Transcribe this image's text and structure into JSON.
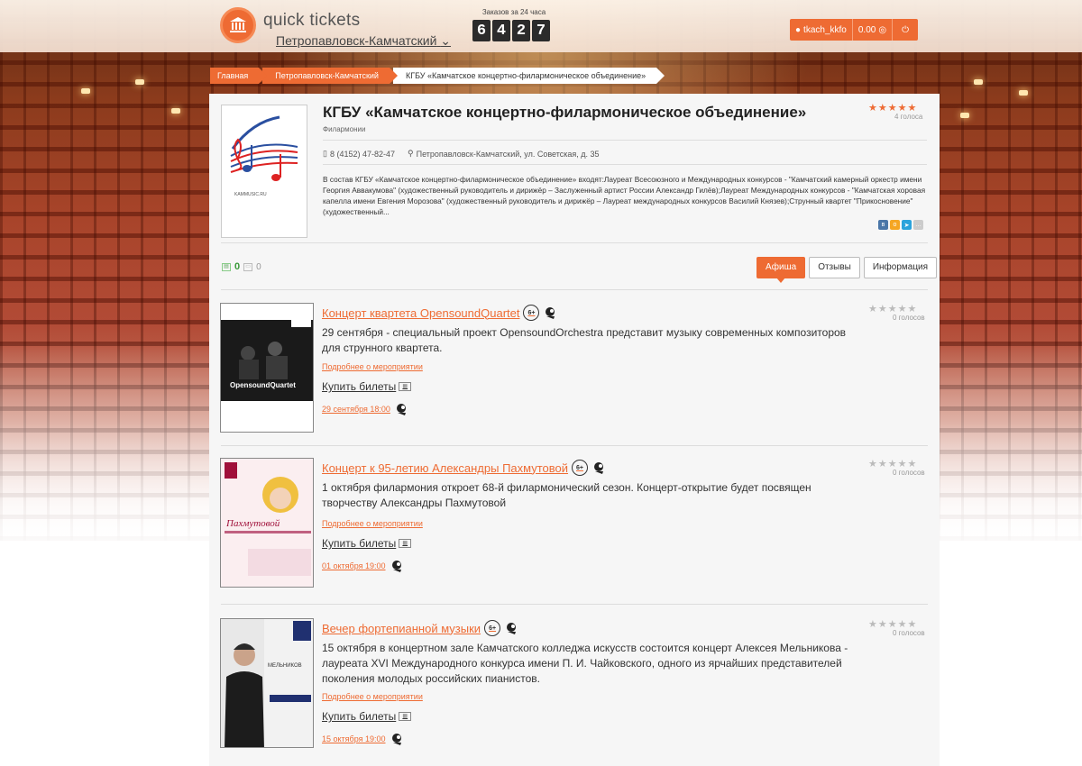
{
  "header": {
    "logo_text": "quick tickets",
    "city": "Петропавловск-Камчатский",
    "counter_label": "Заказов за 24 часа",
    "counter_digits": [
      "6",
      "4",
      "2",
      "7"
    ],
    "user_name": "tkach_kkfo",
    "balance": "0.00"
  },
  "breadcrumb": [
    {
      "label": "Главная"
    },
    {
      "label": "Петропавловск-Камчатский"
    },
    {
      "label": "КГБУ «Камчатское концертно-филармоническое объединение»"
    }
  ],
  "org": {
    "title": "КГБУ «Камчатское концертно-филармоническое объединение»",
    "type": "Филармонии",
    "votes": "4 голоса",
    "phone": "8 (4152) 47-82-47",
    "address": "Петропавловск-Камчатский, ул. Советская, д. 35",
    "description": "В состав КГБУ «Камчатское концертно-филармоническое объединение» входят:Лауреат Всесоюзного и Международных конкурсов - \"Камчатский камерный оркестр имени Георгия Аввакумова\" (художественный руководитель и дирижёр – Заслуженный артист России Александр Гилёв);Лауреат Международных конкурсов - \"Камчатская хоровая капелла имени Евгения Морозова\" (художественный руководитель и дирижёр – Лауреат международных конкурсов Василий Князев);Струнный квартет \"Прикосновение\" (художественный...",
    "logo_caption": "KAMMUSIC.RU",
    "stat_count": "0",
    "stat_reviews": "0"
  },
  "tabs": [
    {
      "label": "Афиша",
      "active": true
    },
    {
      "label": "Отзывы",
      "active": false
    },
    {
      "label": "Информация",
      "active": false
    }
  ],
  "common": {
    "more_link": "Подробнее о мероприятии",
    "buy_label": "Купить билеты",
    "age_badge": "6+",
    "no_votes": "0 голосов"
  },
  "events": [
    {
      "title": "Концерт квартета OpensoundQuartet",
      "text": "29 сентября - специальный проект OpensoundOrchestra представит музыку современных композиторов для струнного квартета.",
      "date": "29 сентября 18:00",
      "poster_caption": "OpensoundQuartet"
    },
    {
      "title": "Концерт к 95-летию Александры Пахмутовой",
      "text": "1 октября филармония откроет 68-й филармонический сезон. Концерт-открытие будет посвящен творчеству Александры Пахмутовой",
      "date": "01 октября 19:00",
      "poster_caption": "Пахмутовой"
    },
    {
      "title": "Вечер фортепианной музыки",
      "text": "15 октября в концертном зале Камчатского колледжа искусств состоится концерт Алексея Мельникова - лауреата XVI Международного конкурса имени П. И. Чайковского, одного из ярчайших представителей поколения молодых российских пианистов.",
      "date": "15 октября 19:00",
      "poster_caption": "МЕЛЬНИКОВ"
    }
  ],
  "colors": {
    "accent": "#ee6b33",
    "panel": "#f6f6f6"
  }
}
